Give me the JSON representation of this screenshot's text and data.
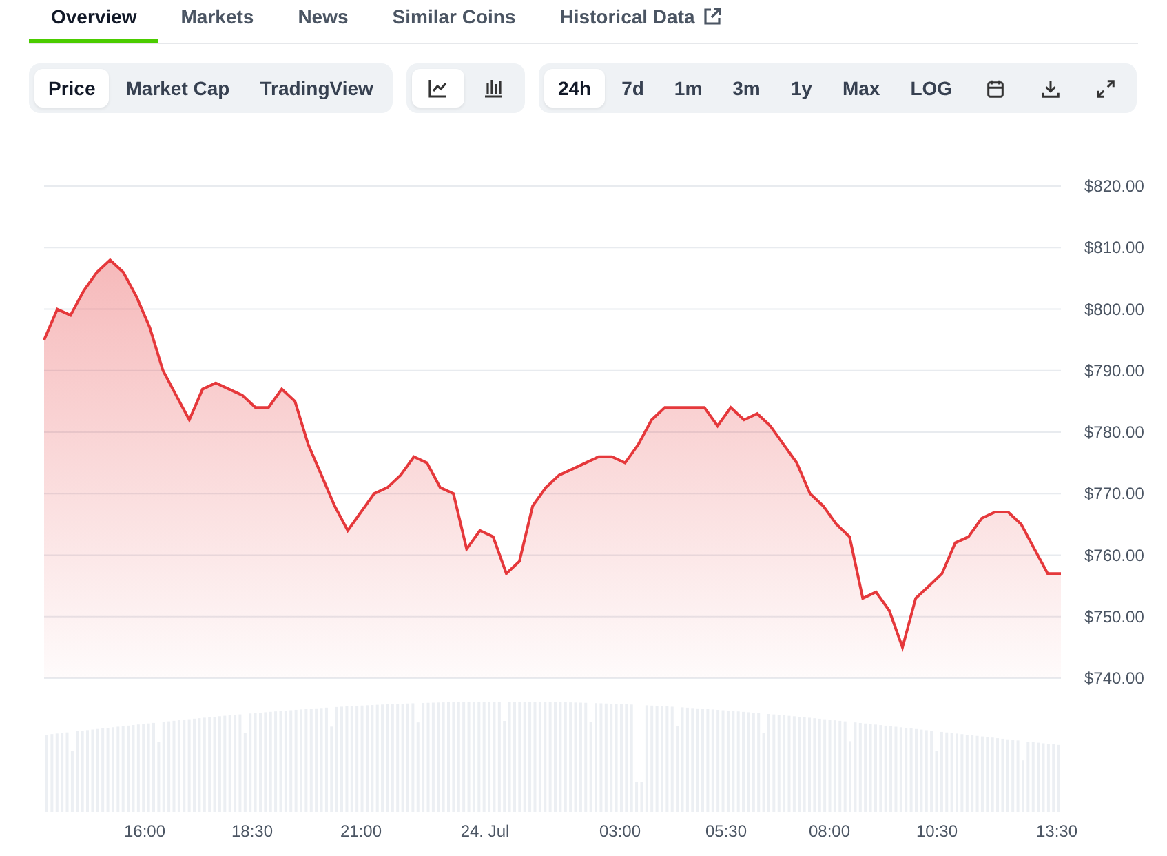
{
  "tabs": [
    {
      "label": "Overview",
      "selected": true,
      "external": false
    },
    {
      "label": "Markets",
      "selected": false,
      "external": false
    },
    {
      "label": "News",
      "selected": false,
      "external": false
    },
    {
      "label": "Similar Coins",
      "selected": false,
      "external": false
    },
    {
      "label": "Historical Data",
      "selected": false,
      "external": true
    }
  ],
  "chart_types": [
    {
      "label": "Price",
      "selected": true
    },
    {
      "label": "Market Cap",
      "selected": false
    },
    {
      "label": "TradingView",
      "selected": false
    }
  ],
  "chart_styles": [
    {
      "kind": "line",
      "selected": true
    },
    {
      "kind": "candles",
      "selected": false
    }
  ],
  "ranges": [
    {
      "label": "24h",
      "selected": true
    },
    {
      "label": "7d",
      "selected": false
    },
    {
      "label": "1m",
      "selected": false
    },
    {
      "label": "3m",
      "selected": false
    },
    {
      "label": "1y",
      "selected": false
    },
    {
      "label": "Max",
      "selected": false
    },
    {
      "label": "LOG",
      "selected": false
    }
  ],
  "tools": [
    {
      "kind": "calendar"
    },
    {
      "kind": "download"
    },
    {
      "kind": "expand"
    }
  ],
  "price_chart": {
    "chart_data": {
      "type": "area",
      "ylim": [
        740,
        820
      ],
      "yticks": [
        {
          "value": 820,
          "label": "$820.00"
        },
        {
          "value": 810,
          "label": "$810.00"
        },
        {
          "value": 800,
          "label": "$800.00"
        },
        {
          "value": 790,
          "label": "$790.00"
        },
        {
          "value": 780,
          "label": "$780.00"
        },
        {
          "value": 770,
          "label": "$770.00"
        },
        {
          "value": 760,
          "label": "$760.00"
        },
        {
          "value": 750,
          "label": "$750.00"
        },
        {
          "value": 740,
          "label": "$740.00"
        }
      ],
      "grid": true,
      "series": [
        {
          "color": "#e5383b",
          "values": [
            795,
            800,
            799,
            803,
            806,
            808,
            806,
            802,
            797,
            790,
            786,
            782,
            787,
            788,
            787,
            786,
            784,
            784,
            787,
            785,
            778,
            773,
            768,
            764,
            767,
            770,
            771,
            773,
            776,
            775,
            771,
            770,
            761,
            764,
            763,
            757,
            759,
            768,
            771,
            773,
            774,
            775,
            776,
            776,
            775,
            778,
            782,
            784,
            784,
            784,
            784,
            781,
            784,
            782,
            783,
            781,
            778,
            775,
            770,
            768,
            765,
            763,
            753,
            754,
            751,
            745,
            753,
            755,
            757,
            762,
            763,
            766,
            767,
            767,
            765,
            761,
            757,
            757
          ]
        }
      ]
    },
    "x_labels": [
      "16:00",
      "18:30",
      "21:00",
      "24. Jul",
      "03:00",
      "05:30",
      "08:00",
      "10:30",
      "13:30"
    ]
  }
}
